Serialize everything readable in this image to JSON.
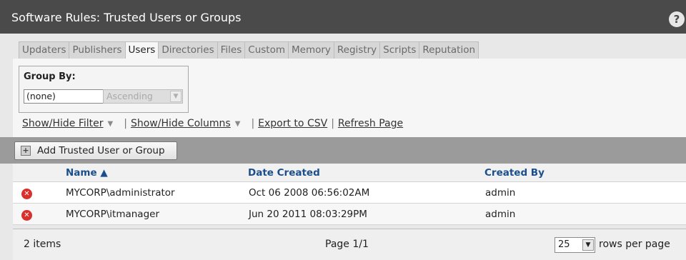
{
  "window": {
    "title": "Software Rules: Trusted Users or Groups",
    "help_label": "?"
  },
  "tabs": [
    {
      "label": "Updaters",
      "active": false
    },
    {
      "label": "Publishers",
      "active": false
    },
    {
      "label": "Users",
      "active": true
    },
    {
      "label": "Directories",
      "active": false
    },
    {
      "label": "Files",
      "active": false
    },
    {
      "label": "Custom",
      "active": false
    },
    {
      "label": "Memory",
      "active": false
    },
    {
      "label": "Registry",
      "active": false
    },
    {
      "label": "Scripts",
      "active": false
    },
    {
      "label": "Reputation",
      "active": false
    }
  ],
  "group_by": {
    "label": "Group By:",
    "value": "(none)",
    "order_value": "Ascending"
  },
  "links": {
    "show_hide_filter": "Show/Hide Filter",
    "show_hide_columns": "Show/Hide Columns",
    "export_csv": "Export to CSV",
    "refresh": "Refresh Page"
  },
  "toolbar": {
    "add_label": "Add Trusted User or Group"
  },
  "table": {
    "columns": {
      "name": "Name ▲",
      "date_created": "Date Created",
      "created_by": "Created By"
    },
    "rows": [
      {
        "name": "MYCORP\\administrator",
        "date_created": "Oct 06 2008 06:56:02AM",
        "created_by": "admin"
      },
      {
        "name": "MYCORP\\itmanager",
        "date_created": "Jun 20 2011 08:03:29PM",
        "created_by": "admin"
      }
    ]
  },
  "footer": {
    "items": "2 items",
    "page": "Page 1/1",
    "rows_value": "25",
    "rows_label": "rows per page"
  },
  "colors": {
    "titlebar": "#4a4a4a",
    "header_link": "#1b4f8c",
    "delete_icon": "#d9302b"
  }
}
